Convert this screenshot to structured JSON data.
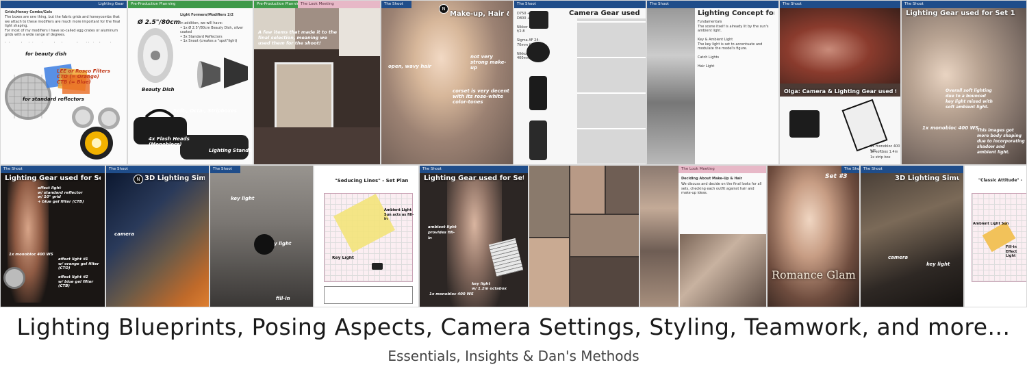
{
  "pages_row1": [
    {
      "bar": "Lighting Gear",
      "title": "Grids/Honey Combs/Gels",
      "text": "The boxes are one thing, but the fabric grids and honeycombs that we attach to these modifiers are much more important for the final light shaping.\nFor most of my modifiers I have so-called egg crates or aluminum grids with a wide range of degrees.\n\nI also pack gels in various colors because I want to implement a specific glamour look for at least one set and do some modifications in others.",
      "notes": [
        "for beauty dish",
        "LEE or Rosco Filters\nCTO (= Orange)\nCTB (= Blue)",
        "for standard reflectors"
      ]
    },
    {
      "bar": "Pre-Production Planning",
      "title": "Light Formers/Modifiers 2/2",
      "text": "In addition, we will have:\n• 1x Ø 2.5\"/80cm Beauty Dish, silver coated\n• 3x Standard Reflectors\n• 1x Snoot (creates a \"spot\"light)",
      "notes": [
        "Ø 2.5\"/80cm",
        "Beauty Dish",
        "Soft-, Octa-, Stripboxes",
        "4x Flash Heads\n(Monoblocs)",
        "Lighting Stands"
      ]
    },
    {
      "bar": "Pre-Production Planning",
      "bar2": "The Look Meeting",
      "notes": [
        "A few items that made it to the final selection, meaning we used them for the shoot!"
      ]
    },
    {
      "bar": "The Shoot",
      "title": "Make-up, Hair & Styling",
      "notes": [
        "open, wavy hair",
        "not very strong make-up",
        "corset is very decent with its rose-white color-tones"
      ]
    },
    {
      "bar": "The Shoot",
      "title": "Camera Gear used for Set 1",
      "text": "D750 + 1,3 MP\nD800 + 36,2MP\n\nNikkor MF 16mm f/2.8\n\nSigma AF 24-70mm f/2.8\n\nNikkor AF 80-400mm f/4.5-5.6"
    },
    {
      "bar": "The Shoot",
      "title": "Lighting Concept for Set 1",
      "text": "Fundamentals\nThe scene itself is already lit by the sun's ambient light.\n\nKey & Ambient Light\nThe key light is set to accentuate and modulate the model's figure.\n\nCatch Lights\n\nHair Light"
    },
    {
      "bar": "The Shoot",
      "title": "Olga: Camera & Lighting Gear used for Set",
      "notes": [
        "1x monobloc 400 WS",
        "1x softbox 1.4m",
        "1x strip box"
      ]
    },
    {
      "bar": "The Shoot",
      "title": "Lighting Gear used for Set 1",
      "notes": [
        "Overall soft lighting due to a bounced key light mixed with soft ambient light.",
        "1x monobloc 400 WS",
        "This images got more body shaping due to incorporating shadow and ambient light."
      ]
    }
  ],
  "pages_row2": [
    {
      "bar": "The Shoot",
      "title": "Lighting Gear used for Set 3",
      "notes": [
        "effect light\nw/ standard reflector\nw/ 10° grid\n+ blue gel filter (CTB)",
        "1x monobloc 400 WS",
        "effect light #1\nw/ orange gel filter (CTO)",
        "effect light #2\nw/ blue gel filter (CTB)"
      ]
    },
    {
      "bar": "The Shoot",
      "title": "3D Lighting Simulation",
      "notes": [
        "camera"
      ]
    },
    {
      "bar": "The Shoot",
      "notes": [
        "key light",
        "key light",
        "fill-in"
      ]
    },
    {
      "bar": "The Shoot",
      "title": "\"Seducing Lines\" - Set Plan",
      "notes": [
        "Ambient Light Sun acts as fill-in",
        "Key Light"
      ]
    },
    {
      "bar": "The Shoot",
      "title": "Lighting Gear used for Set 4",
      "notes": [
        "ambient light provides fill-in",
        "key light\nw/ 1.2m octabox",
        "1x monobloc 400 WS"
      ]
    },
    {
      "bar": "The Look Meeting",
      "title": "Deciding About Make-Up & Hair",
      "text": "We discuss and decide on the final looks for all sets, checking each outfit against hair and make-up ideas."
    },
    {
      "bar": "The Shoot",
      "title": "Romance Glam",
      "notes": [
        "Set #3",
        "effect/rim light",
        "softbox"
      ]
    },
    {
      "bar": "The Shoot",
      "title": "3D Lighting Simulation",
      "notes": [
        "camera",
        "key light"
      ]
    },
    {
      "bar": "The Shoot",
      "title": "\"Classic Attitude\" - Set",
      "notes": [
        "Ambient Light Sun",
        "Fill-in Effect Light"
      ]
    }
  ],
  "headline": "Lighting Blueprints, Posing Aspects, Camera Settings, Styling, Teamwork, and more...",
  "subline": "Essentials, Insights & Dan's Methods",
  "colors": {
    "bar_blue": "#1f4d8a",
    "bar_green": "#3f9a4a",
    "bar_pink": "#e7b8c7",
    "accent_yellow": "#f3e37a"
  }
}
